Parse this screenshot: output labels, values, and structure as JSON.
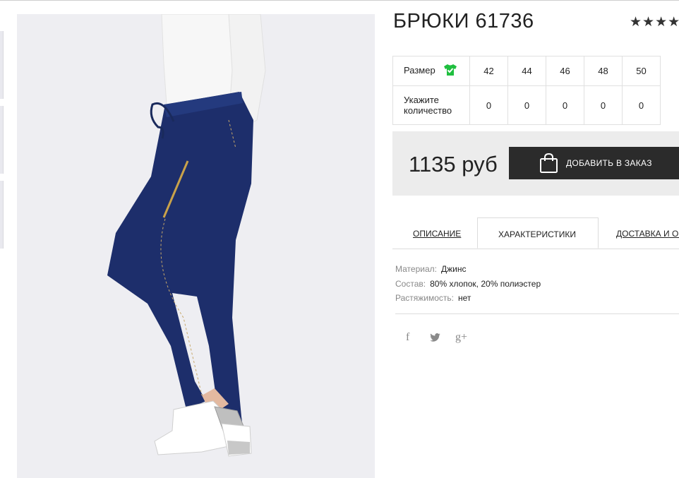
{
  "product": {
    "title": "БРЮКИ 61736",
    "rating_stars": "★★★★"
  },
  "sizes": {
    "size_label": "Размер",
    "qty_label_line1": "Укажите",
    "qty_label_line2": "количество",
    "values": [
      "42",
      "44",
      "46",
      "48",
      "50"
    ],
    "quantities": [
      "0",
      "0",
      "0",
      "0",
      "0"
    ]
  },
  "buy": {
    "price": "1135 руб",
    "add_button": "ДОБАВИТЬ В ЗАКАЗ"
  },
  "tabs": {
    "description": "ОПИСАНИЕ",
    "characteristics": "ХАРАКТЕРИСТИКИ",
    "delivery": "ДОСТАВКА И ОПЛАТА",
    "active": "characteristics"
  },
  "specs": [
    {
      "key": "Материал:",
      "value": "Джинс"
    },
    {
      "key": "Состав:",
      "value": "80% хлопок, 20% полиэстер"
    },
    {
      "key": "Растяжимость:",
      "value": "нет"
    }
  ],
  "social": {
    "facebook": "f",
    "twitter": "twitter-icon",
    "google_plus": "g+"
  },
  "colors": {
    "button_bg": "#2b2b2b",
    "buy_box_bg": "#ececec",
    "tshirt_icon": "#1fbf3f",
    "denim": "#1d2e6b"
  }
}
